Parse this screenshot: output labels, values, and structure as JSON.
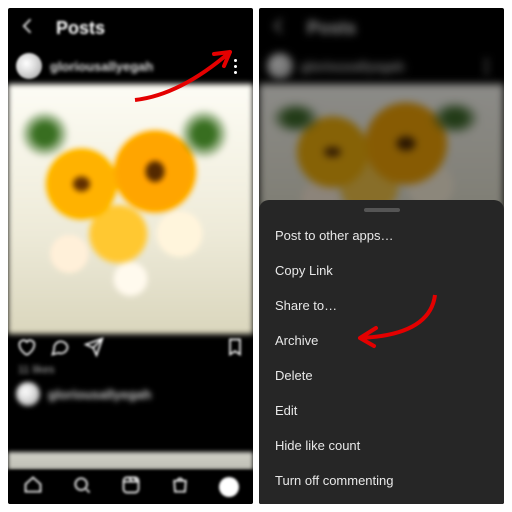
{
  "left": {
    "title": "Posts",
    "username": "gloriousallyegah",
    "likes": "11 likes"
  },
  "right": {
    "title": "Posts",
    "username": "gloriousallyegah"
  },
  "sheet": {
    "items": [
      "Post to other apps…",
      "Copy Link",
      "Share to…",
      "Archive",
      "Delete",
      "Edit",
      "Hide like count",
      "Turn off commenting"
    ]
  },
  "annotations": {
    "arrow1": "arrow-to-more-options",
    "arrow2": "arrow-to-archive"
  }
}
